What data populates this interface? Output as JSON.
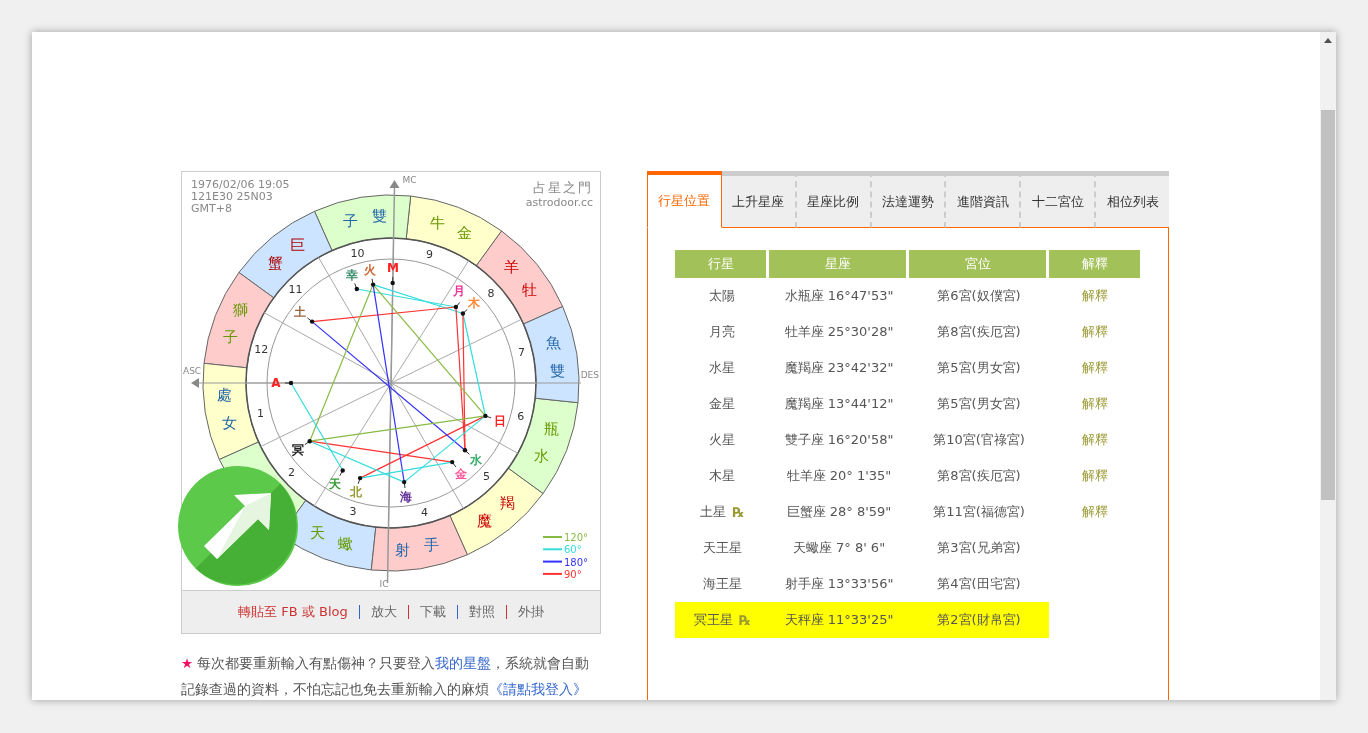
{
  "chart": {
    "birth_info": [
      "1976/02/06 19:05",
      "121E30 25N03",
      "GMT+8"
    ],
    "site_name": "占星之門",
    "site_url": "astrodoor.cc",
    "axes": {
      "mc": "MC",
      "asc": "ASC",
      "des": "DES",
      "ic": "IC"
    },
    "signs": [
      {
        "name": "羊牡",
        "color": "#ffcccc"
      },
      {
        "name": "牛金",
        "color": "#ffffcc"
      },
      {
        "name": "子雙",
        "color": "#ddffcc"
      },
      {
        "name": "蟹巨",
        "color": "#cce4ff"
      },
      {
        "name": "獅子",
        "color": "#ffcccc"
      },
      {
        "name": "處女",
        "color": "#ffffcc"
      },
      {
        "color": "#ddffcc"
      },
      {
        "name": "天蠍",
        "color": "#cce4ff"
      },
      {
        "name": "射手",
        "color": "#ffcccc"
      },
      {
        "name": "魔羯",
        "color": "#ffffcc"
      },
      {
        "name": "瓶水",
        "color": "#ddffcc"
      },
      {
        "name": "魚雙",
        "color": "#cce4ff"
      }
    ],
    "houses": [
      "1",
      "2",
      "3",
      "4",
      "5",
      "6",
      "7",
      "8",
      "9",
      "10",
      "11",
      "12"
    ],
    "planets": [
      {
        "label": "日",
        "color": "#ff2020"
      },
      {
        "label": "月",
        "color": "#ee3399"
      },
      {
        "label": "水",
        "color": "#33aa66"
      },
      {
        "label": "金",
        "color": "#ff5599"
      },
      {
        "label": "火",
        "color": "#cc6633"
      },
      {
        "label": "木",
        "color": "#ff8833"
      },
      {
        "label": "土",
        "color": "#996644"
      },
      {
        "label": "天",
        "color": "#339933"
      },
      {
        "label": "海",
        "color": "#663399"
      },
      {
        "label": "冥",
        "color": "#222222"
      },
      {
        "label": "北",
        "color": "#999933"
      },
      {
        "label": "A",
        "color": "#ff2020"
      },
      {
        "label": "M",
        "color": "#ff2020"
      },
      {
        "label": "幸",
        "color": "#338866"
      }
    ],
    "legend": [
      {
        "label": "120°",
        "color": "#88bb44"
      },
      {
        "label": "60°",
        "color": "#33dddd"
      },
      {
        "label": "180°",
        "color": "#3333ff"
      },
      {
        "label": "90°",
        "color": "#ff3333"
      }
    ]
  },
  "chart_links": [
    {
      "label": "轉貼至 FB 或 Blog",
      "kind": "share"
    },
    {
      "label": "放大",
      "kind": "plain"
    },
    {
      "label": "下載",
      "kind": "plain"
    },
    {
      "label": "對照",
      "kind": "plain"
    },
    {
      "label": "外掛",
      "kind": "plain"
    }
  ],
  "notice": {
    "star": "★",
    "text_1": "每次都要重新輸入有點傷神？只要登入",
    "link_1": "我的星盤",
    "text_2": "，系統就會自動記錄查過的資料，不怕忘記也免去重新輸入的麻煩",
    "link_2": "《請點我登入》"
  },
  "tabs": [
    {
      "label": "行星位置",
      "selected": true
    },
    {
      "label": "上升星座",
      "selected": false
    },
    {
      "label": "星座比例",
      "selected": false
    },
    {
      "label": "法達運勢",
      "selected": false
    },
    {
      "label": "進階資訊",
      "selected": false
    },
    {
      "label": "十二宮位",
      "selected": false
    },
    {
      "label": "相位列表",
      "selected": false
    }
  ],
  "table": {
    "columns": [
      "行星",
      "星座",
      "宮位",
      "解釋"
    ],
    "rows": [
      {
        "planet": "太陽",
        "sign": "水瓶座 16°47'53\"",
        "house": "第6宮(奴僕宮)",
        "explain": "解釋",
        "highlighted": false
      },
      {
        "planet": "月亮",
        "sign": "牡羊座 25°30'28\"",
        "house": "第8宮(疾厄宮)",
        "explain": "解釋",
        "highlighted": false
      },
      {
        "planet": "水星",
        "sign": "魔羯座 23°42'32\"",
        "house": "第5宮(男女宮)",
        "explain": "解釋",
        "highlighted": false
      },
      {
        "planet": "金星",
        "sign": "魔羯座 13°44'12\"",
        "house": "第5宮(男女宮)",
        "explain": "解釋",
        "highlighted": false
      },
      {
        "planet": "火星",
        "sign": "雙子座 16°20'58\"",
        "house": "第10宮(官祿宮)",
        "explain": "解釋",
        "highlighted": false
      },
      {
        "planet": "木星",
        "sign": "牡羊座 20° 1'35\"",
        "house": "第8宮(疾厄宮)",
        "explain": "解釋",
        "highlighted": false
      },
      {
        "planet": "土星",
        "retro": "℞",
        "sign": "巨蟹座 28° 8'59\"",
        "house": "第11宮(福德宮)",
        "explain": "解釋",
        "highlighted": false
      },
      {
        "planet": "天王星",
        "sign": "天蠍座 7° 8' 6\"",
        "house": "第3宮(兄弟宮)",
        "highlighted": false
      },
      {
        "planet": "海王星",
        "sign": "射手座 13°33'56\"",
        "house": "第4宮(田宅宮)",
        "highlighted": false
      },
      {
        "planet": "冥王星",
        "retro": "℞",
        "sign": "天秤座 11°33'25\"",
        "house": "第2宮(財帛宮)",
        "highlighted": true
      }
    ]
  }
}
